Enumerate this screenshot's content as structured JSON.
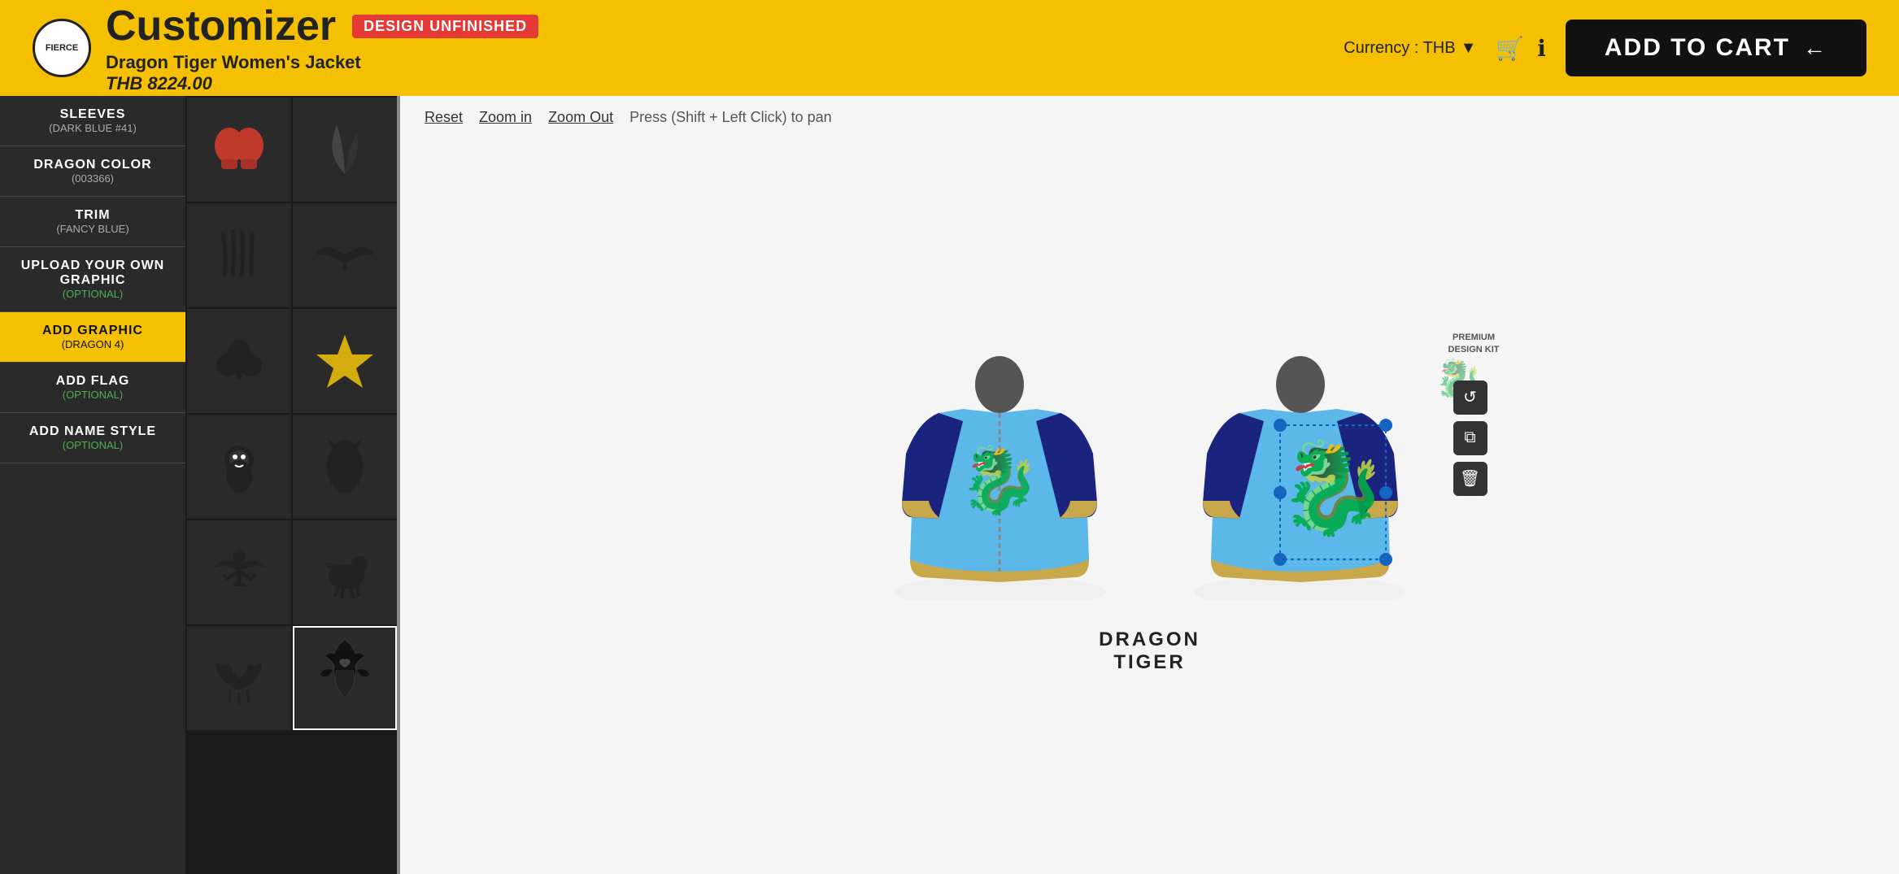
{
  "header": {
    "logo_text": "FIERCE",
    "title": "Customizer",
    "badge": "DESIGN UNFINISHED",
    "product_name": "Dragon Tiger Women's Jacket",
    "product_price": "THB 8224.00",
    "currency_label": "Currency : THB",
    "add_to_cart_label": "ADD TO CART",
    "cart_icon": "🛒",
    "info_icon": "ℹ"
  },
  "canvas": {
    "reset_label": "Reset",
    "zoom_in_label": "Zoom in",
    "zoom_out_label": "Zoom Out",
    "pan_hint": "Press (Shift + Left Click) to pan",
    "jacket_label_line1": "DRAGON",
    "jacket_label_line2": "TIGER",
    "premium_line1": "PREMIUM",
    "premium_line2": "DESIGN KIT"
  },
  "sidebar": {
    "items": [
      {
        "id": "sleeves",
        "title": "SLEEVES",
        "subtitle": "(DARK BLUE #41)",
        "active": false,
        "optional": false
      },
      {
        "id": "dragon-color",
        "title": "DRAGON COLOR",
        "subtitle": "(003366)",
        "active": false,
        "optional": false
      },
      {
        "id": "trim",
        "title": "TRIM",
        "subtitle": "(FANCY BLUE)",
        "active": false,
        "optional": false
      },
      {
        "id": "upload-graphic",
        "title": "UPLOAD YOUR OWN GRAPHIC",
        "subtitle": "(OPTIONAL)",
        "active": false,
        "optional": true
      },
      {
        "id": "add-graphic",
        "title": "ADD GRAPHIC",
        "subtitle": "(DRAGON 4)",
        "active": true,
        "optional": false
      },
      {
        "id": "add-flag",
        "title": "ADD FLAG",
        "subtitle": "(OPTIONAL)",
        "active": false,
        "optional": true
      },
      {
        "id": "add-name-style",
        "title": "ADD NAME STYLE",
        "subtitle": "(OPTIONAL)",
        "active": false,
        "optional": true
      }
    ]
  },
  "graphics": [
    {
      "id": "g1",
      "name": "boxing-gloves",
      "symbol": "🥊",
      "selected": false
    },
    {
      "id": "g2",
      "name": "fern-leaf",
      "symbol": "🌿",
      "selected": false
    },
    {
      "id": "g3",
      "name": "claw-marks",
      "symbol": "⚔",
      "selected": false
    },
    {
      "id": "g4",
      "name": "wings",
      "symbol": "🦅",
      "selected": false
    },
    {
      "id": "g5",
      "name": "shamrock",
      "symbol": "☘",
      "selected": false
    },
    {
      "id": "g6",
      "name": "star",
      "symbol": "⭐",
      "selected": false
    },
    {
      "id": "g7",
      "name": "lion",
      "symbol": "🦁",
      "selected": false
    },
    {
      "id": "g8",
      "name": "lion-rampant",
      "symbol": "♟",
      "selected": false
    },
    {
      "id": "g9",
      "name": "winged-figure",
      "symbol": "🦋",
      "selected": false
    },
    {
      "id": "g10",
      "name": "pegasus",
      "symbol": "🐉",
      "selected": false
    },
    {
      "id": "g11",
      "name": "winged-crest",
      "symbol": "🦉",
      "selected": false
    },
    {
      "id": "g12",
      "name": "dragon-4",
      "symbol": "🐲",
      "selected": true
    }
  ]
}
